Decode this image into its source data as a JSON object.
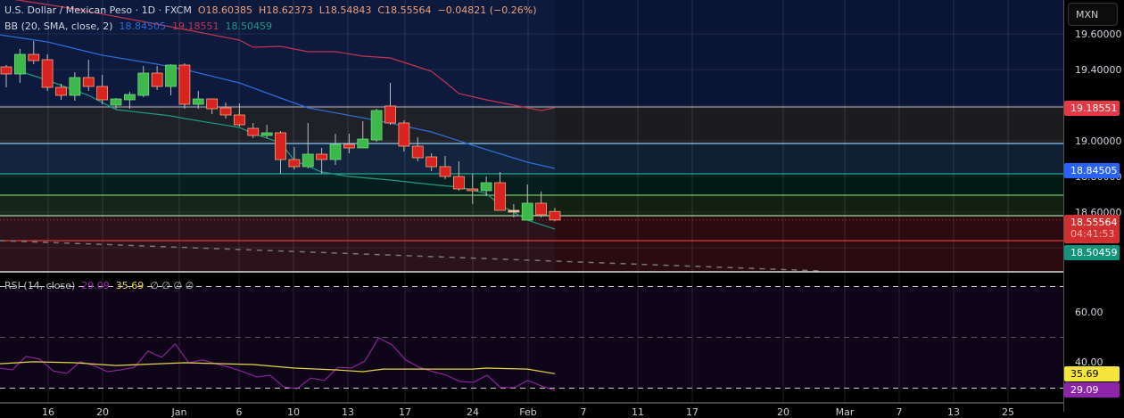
{
  "header": {
    "symbol": "U.S. Dollar / Mexican Peso · 1D · FXCM",
    "open": "O18.60385",
    "high": "H18.62373",
    "low": "L18.54843",
    "close": "C18.55564",
    "change": "−0.04821 (−0.26%)"
  },
  "bb": {
    "label": "BB (20, SMA, close, 2)",
    "basis": "18.84505",
    "upper": "19.18551",
    "lower": "18.50459"
  },
  "rsi": {
    "label": "RSI (14, close)",
    "value": "29.09",
    "ma": "35.69",
    "extra": [
      "∅",
      "∅",
      "∅",
      "∅"
    ]
  },
  "axis": {
    "currency": "MXN",
    "ticks": [
      "19.60000",
      "19.40000",
      "19.00000",
      "18.80000",
      "18.60000"
    ],
    "rsi_ticks": [
      "60.00",
      "40.00"
    ],
    "tags": {
      "upper": "19.18551",
      "basis": "18.84505",
      "last": "18.55564",
      "countdown": "04:41:53",
      "lower": "18.50459",
      "rsi_ma": "35.69",
      "rsi": "29.09"
    }
  },
  "x_labels": [
    "16",
    "20",
    "Jan",
    "6",
    "10",
    "13",
    "17",
    "24",
    "Feb",
    "7",
    "11",
    "17",
    "20",
    "Mar",
    "7",
    "13",
    "25"
  ],
  "colors": {
    "up": "#3db84a",
    "down": "#d8231f",
    "upper": "#c2344f",
    "basis": "#2f6bd8",
    "lower": "#1f9a80",
    "rsi": "#9c27b0",
    "rsi_ma": "#e6d44a"
  },
  "chart_data": {
    "type": "candlestick",
    "ylim": [
      18.275,
      19.79
    ],
    "candles": [
      [
        19.415,
        19.425,
        19.3,
        19.375
      ],
      [
        19.375,
        19.515,
        19.325,
        19.485
      ],
      [
        19.485,
        19.56,
        19.43,
        19.45
      ],
      [
        19.455,
        19.485,
        19.28,
        19.3
      ],
      [
        19.3,
        19.32,
        19.23,
        19.255
      ],
      [
        19.255,
        19.385,
        19.225,
        19.355
      ],
      [
        19.355,
        19.455,
        19.28,
        19.305
      ],
      [
        19.305,
        19.37,
        19.205,
        19.23
      ],
      [
        19.2,
        19.24,
        19.18,
        19.235
      ],
      [
        19.23,
        19.275,
        19.18,
        19.26
      ],
      [
        19.255,
        19.42,
        19.245,
        19.38
      ],
      [
        19.38,
        19.42,
        19.285,
        19.305
      ],
      [
        19.305,
        19.43,
        19.255,
        19.425
      ],
      [
        19.425,
        19.435,
        19.18,
        19.205
      ],
      [
        19.205,
        19.28,
        19.18,
        19.235
      ],
      [
        19.235,
        19.235,
        19.15,
        19.18
      ],
      [
        19.185,
        19.215,
        19.125,
        19.145
      ],
      [
        19.145,
        19.21,
        19.08,
        19.09
      ],
      [
        19.07,
        19.1,
        19.015,
        19.03
      ],
      [
        19.03,
        19.09,
        19.015,
        19.045
      ],
      [
        19.045,
        19.055,
        18.815,
        18.895
      ],
      [
        18.895,
        18.965,
        18.84,
        18.855
      ],
      [
        18.855,
        19.1,
        18.845,
        18.925
      ],
      [
        18.925,
        18.96,
        18.815,
        18.895
      ],
      [
        18.895,
        19.04,
        18.865,
        18.98
      ],
      [
        18.98,
        19.04,
        18.93,
        18.96
      ],
      [
        18.96,
        19.11,
        18.96,
        19.01
      ],
      [
        19.005,
        19.18,
        18.995,
        19.17
      ],
      [
        19.195,
        19.325,
        19.09,
        19.1
      ],
      [
        19.1,
        19.115,
        18.94,
        18.97
      ],
      [
        18.97,
        19.02,
        18.885,
        18.905
      ],
      [
        18.91,
        18.93,
        18.83,
        18.855
      ],
      [
        18.855,
        18.915,
        18.785,
        18.8
      ],
      [
        18.8,
        18.885,
        18.72,
        18.73
      ],
      [
        18.73,
        18.815,
        18.645,
        18.72
      ],
      [
        18.72,
        18.8,
        18.69,
        18.765
      ],
      [
        18.765,
        18.825,
        18.61,
        18.61
      ],
      [
        18.61,
        18.645,
        18.57,
        18.61
      ],
      [
        18.555,
        18.755,
        18.555,
        18.65
      ],
      [
        18.65,
        18.715,
        18.57,
        18.585
      ],
      [
        18.60385,
        18.62373,
        18.54843,
        18.55564
      ]
    ],
    "bb_upper": [
      [
        0,
        19.8
      ],
      [
        5,
        19.74
      ],
      [
        12,
        19.64
      ],
      [
        17,
        19.565
      ],
      [
        18,
        19.525
      ],
      [
        20,
        19.53
      ],
      [
        22,
        19.5
      ],
      [
        24,
        19.5
      ],
      [
        26,
        19.475
      ],
      [
        28,
        19.465
      ],
      [
        30,
        19.415
      ],
      [
        31,
        19.39
      ],
      [
        32,
        19.33
      ],
      [
        33,
        19.265
      ],
      [
        35,
        19.23
      ],
      [
        37,
        19.2
      ],
      [
        39,
        19.17
      ],
      [
        40,
        19.18551
      ]
    ],
    "bb_basis": [
      [
        -0.5,
        19.595
      ],
      [
        3,
        19.555
      ],
      [
        7,
        19.48
      ],
      [
        11,
        19.43
      ],
      [
        13,
        19.4
      ],
      [
        17,
        19.325
      ],
      [
        20,
        19.24
      ],
      [
        22,
        19.185
      ],
      [
        27,
        19.115
      ],
      [
        31,
        19.05
      ],
      [
        34,
        18.975
      ],
      [
        38,
        18.88
      ],
      [
        40,
        18.84505
      ]
    ],
    "bb_lower": [
      [
        1,
        19.39
      ],
      [
        3,
        19.34
      ],
      [
        6,
        19.255
      ],
      [
        8,
        19.175
      ],
      [
        12,
        19.14
      ],
      [
        13,
        19.125
      ],
      [
        17,
        19.075
      ],
      [
        18,
        19.04
      ],
      [
        20,
        18.99
      ],
      [
        21,
        18.89
      ],
      [
        23,
        18.825
      ],
      [
        25,
        18.8
      ],
      [
        28,
        18.78
      ],
      [
        31,
        18.755
      ],
      [
        33,
        18.74
      ],
      [
        35,
        18.705
      ],
      [
        36,
        18.64
      ],
      [
        37,
        18.6
      ],
      [
        38,
        18.555
      ],
      [
        40,
        18.50459
      ]
    ],
    "levels": [
      19.19,
      18.985,
      18.815,
      18.695,
      18.58,
      18.44
    ],
    "rsi": [
      37.9,
      37.2,
      42.5,
      41.4,
      36.8,
      35.8,
      40.4,
      38.9,
      36.5,
      37.2,
      38.2,
      44.6,
      42.1,
      47.4,
      40.0,
      41.1,
      39.6,
      38.2,
      36.5,
      34.4,
      35.1,
      30.5,
      29.8,
      34.0,
      33.0,
      38.2,
      37.9,
      40.7,
      49.8,
      47.0,
      41.1,
      38.2,
      36.5,
      35.1,
      32.6,
      32.3,
      35.1,
      30.2,
      30.2,
      33.0,
      30.9,
      29.09
    ],
    "rsi_ma": [
      [
        -0.5,
        39.6
      ],
      [
        2,
        40.4
      ],
      [
        5,
        40
      ],
      [
        8,
        38.9
      ],
      [
        13,
        40
      ],
      [
        18,
        39.3
      ],
      [
        21,
        37.9
      ],
      [
        24,
        37.2
      ],
      [
        26,
        36.5
      ],
      [
        27.5,
        37.5
      ],
      [
        30,
        37.5
      ],
      [
        34,
        37.5
      ],
      [
        35,
        37.9
      ],
      [
        38,
        37.5
      ],
      [
        40,
        35.69
      ]
    ],
    "rsi_levels": [
      70,
      50,
      30
    ]
  }
}
